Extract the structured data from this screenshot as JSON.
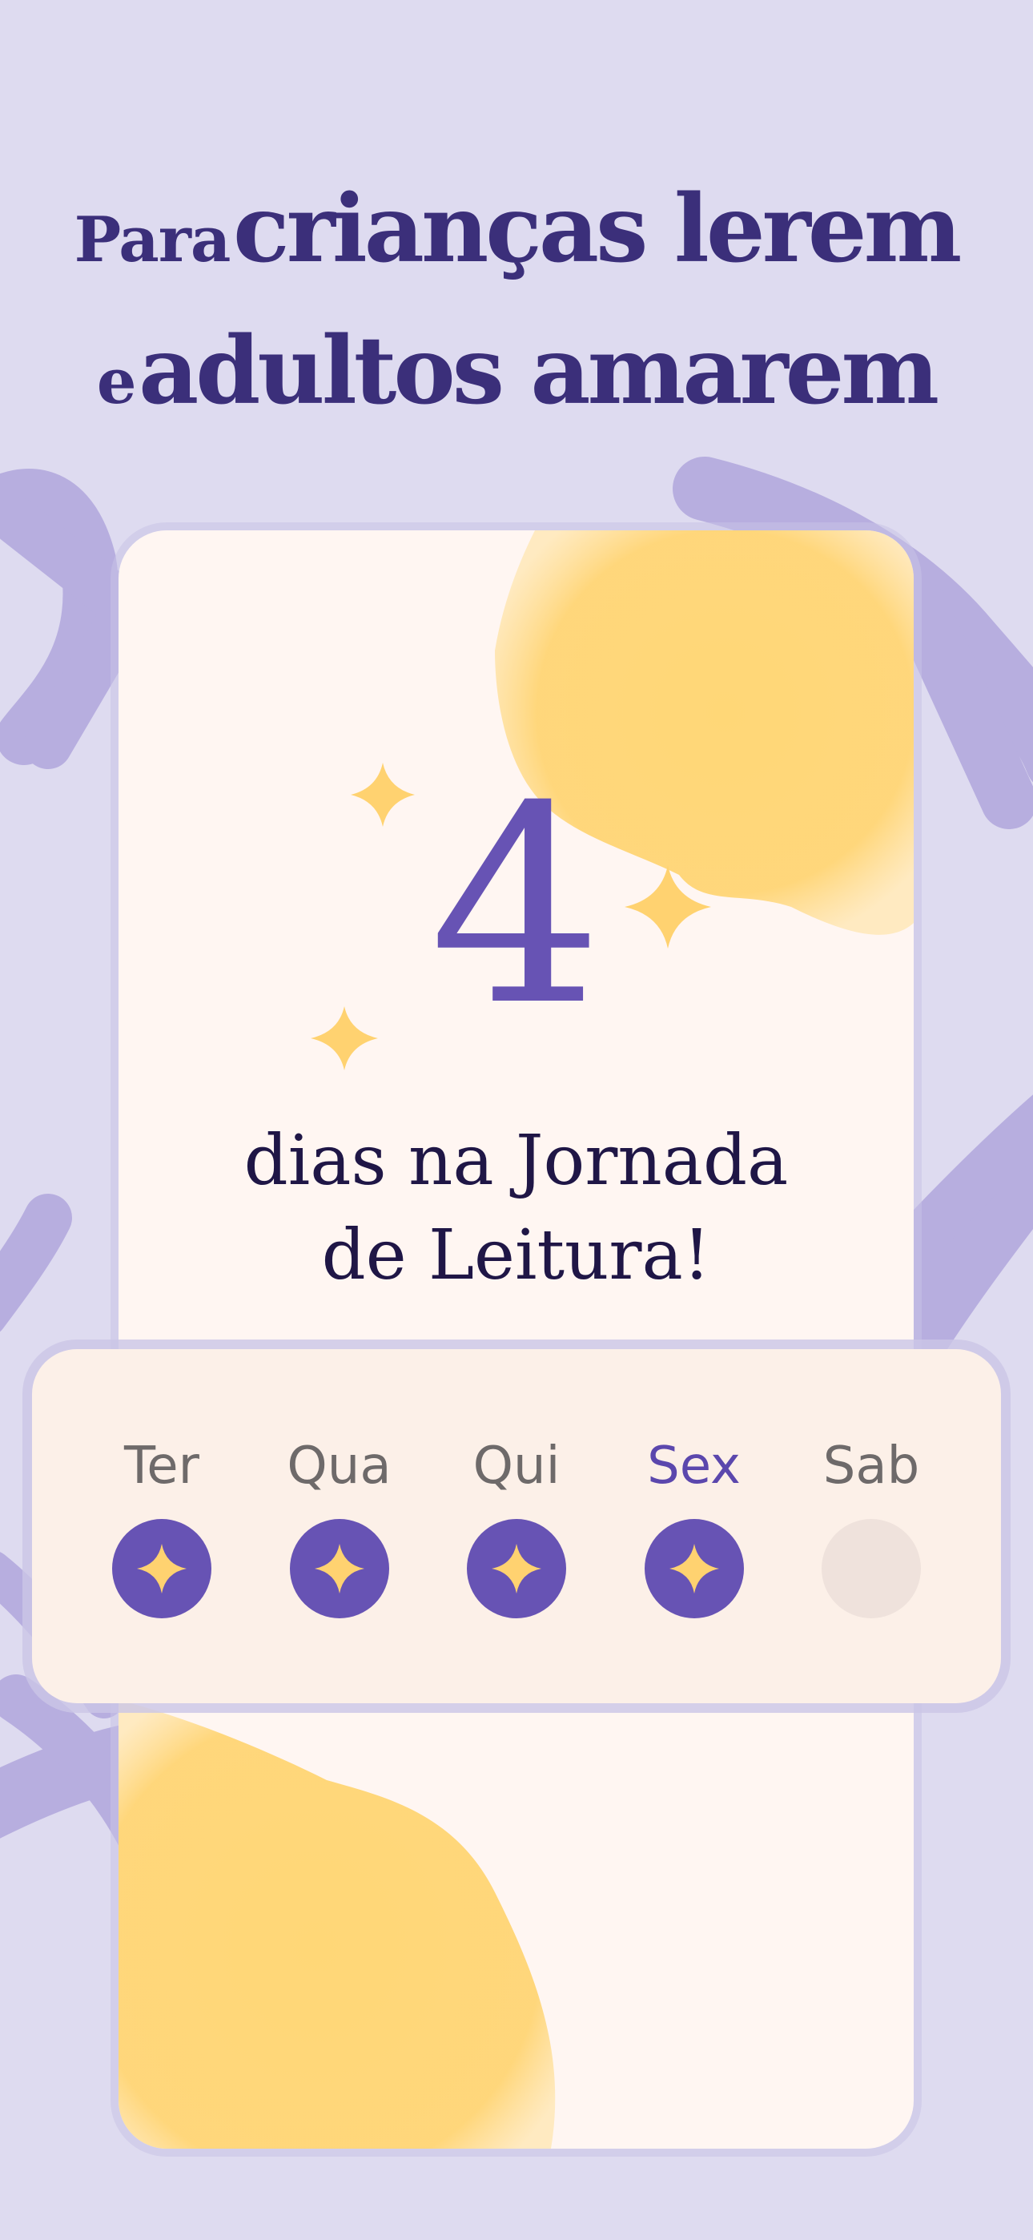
{
  "headline": {
    "line1_small": "Para",
    "line1_big": "crianças lerem",
    "line2_small": "e",
    "line2_big": "adultos amarem"
  },
  "streak": {
    "count": "4",
    "caption_line1": "dias na Jornada",
    "caption_line2": "de Leitura!"
  },
  "week": [
    {
      "label": "Ter",
      "completed": true,
      "current": false,
      "icon": "sparkle-icon"
    },
    {
      "label": "Qua",
      "completed": true,
      "current": false,
      "icon": "sparkle-icon"
    },
    {
      "label": "Qui",
      "completed": true,
      "current": false,
      "icon": "sparkle-icon"
    },
    {
      "label": "Sex",
      "completed": true,
      "current": true,
      "icon": "sparkle-icon"
    },
    {
      "label": "Sab",
      "completed": false,
      "current": false,
      "icon": ""
    }
  ],
  "colors": {
    "background": "#dedbf0",
    "accent_purple": "#6753b4",
    "headline": "#3b2f7a",
    "star_yellow": "#ffd270",
    "card": "#fff6f2",
    "week_card": "#fcf0e8"
  }
}
